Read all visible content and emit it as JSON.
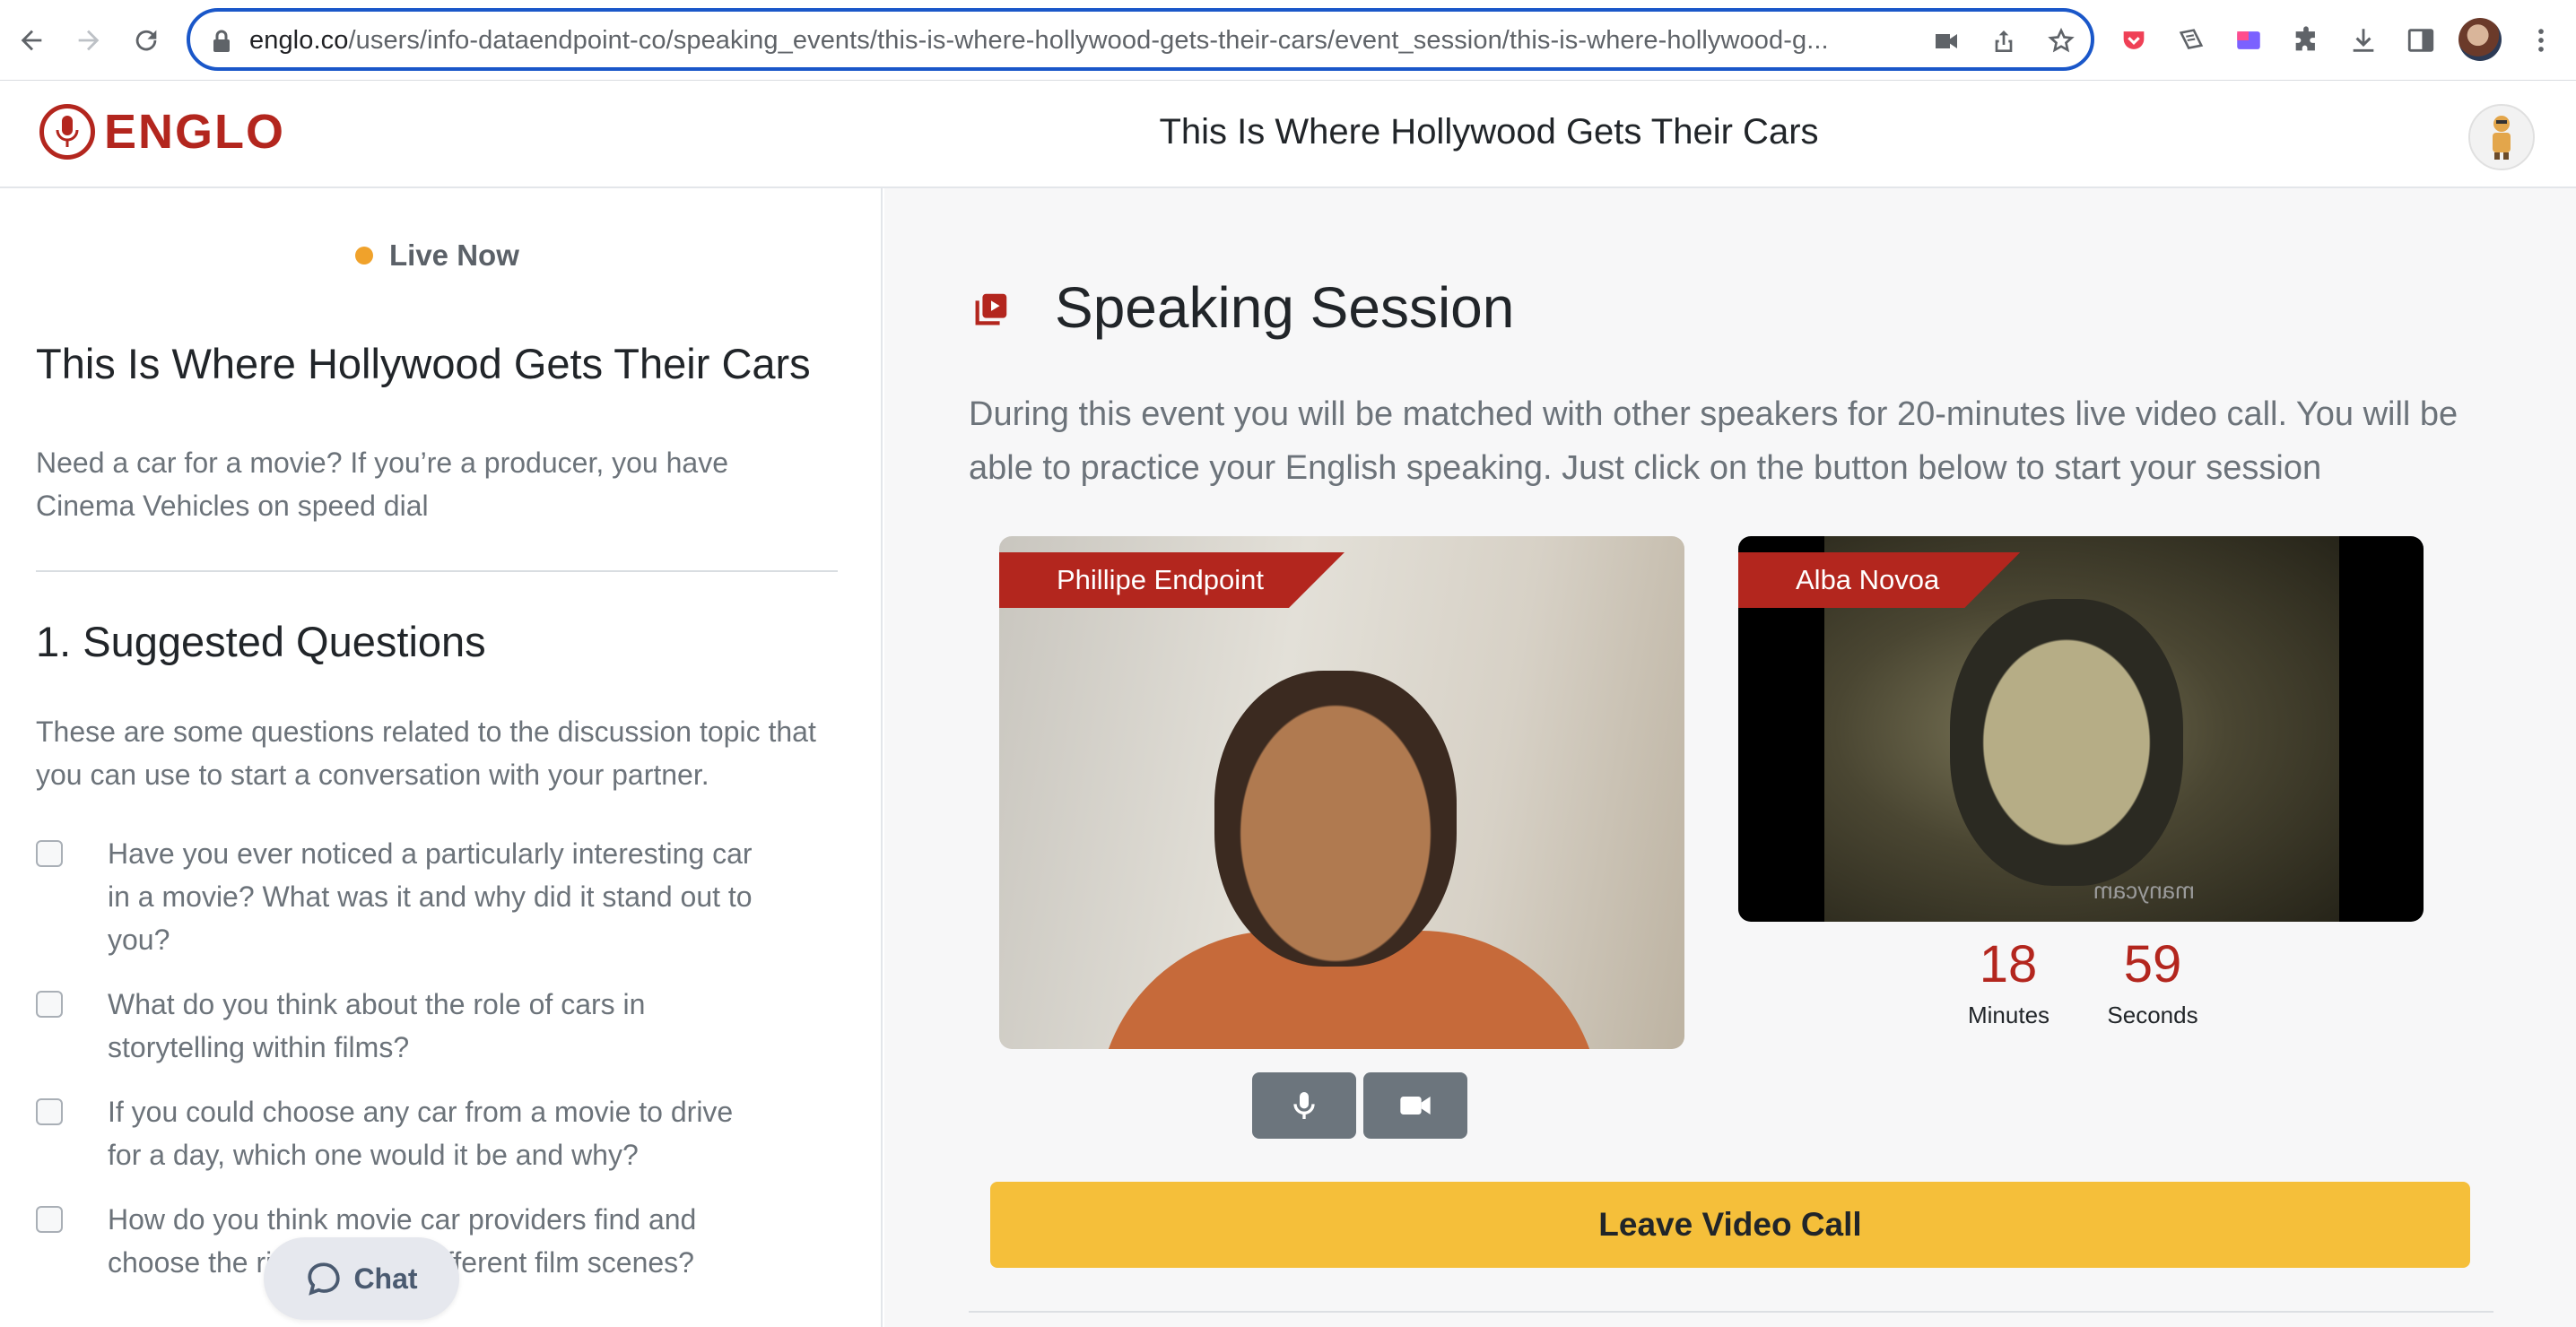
{
  "browser": {
    "url_domain": "englo.co",
    "url_path": "/users/info-dataendpoint-co/speaking_events/this-is-where-hollywood-gets-their-cars/event_session/this-is-where-hollywood-g..."
  },
  "header": {
    "logo_text": "ENGLO",
    "title": "This Is Where Hollywood Gets Their Cars"
  },
  "left": {
    "live_label": "Live Now",
    "title": "This Is Where Hollywood Gets Their Cars",
    "description": "Need a car for a movie? If you’re a producer, you have Cinema Vehicles on speed dial",
    "section_title": "1. Suggested Questions",
    "section_intro": "These are some questions related to the discussion topic that you can use to start a conversation with your partner.",
    "questions": [
      "Have you ever noticed a particularly interesting car in a movie? What was it and why did it stand out to you?",
      "What do you think about the role of cars in storytelling within films?",
      "If you could choose any car from a movie to drive for a day, which one would it be and why?",
      "How do you think movie car providers find and choose the right cars for different film scenes?"
    ],
    "chat_label": "Chat"
  },
  "session": {
    "title": "Speaking Session",
    "description": "During this event you will be matched with other speakers for 20-minutes live video call. You will be able to practice your English speaking. Just click on the button below to start your session",
    "local_name": "Phillipe Endpoint",
    "remote_name": "Alba Novoa",
    "watermark": "manycam",
    "timer": {
      "minutes": "18",
      "minutes_label": "Minutes",
      "seconds": "59",
      "seconds_label": "Seconds"
    },
    "leave_label": "Leave Video Call"
  },
  "colors": {
    "brand": "#b3261e",
    "accent": "#f5bf3a",
    "live": "#f0a22b"
  }
}
